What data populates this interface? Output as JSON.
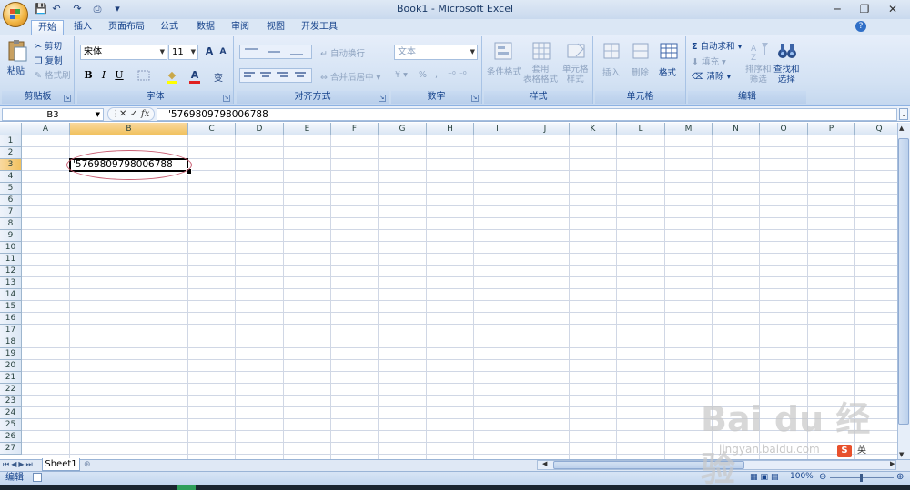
{
  "title_bar": {
    "title": "Book1 - Microsoft Excel",
    "minimize": "─",
    "restore": "❐",
    "close": "✕"
  },
  "qat": {
    "save": "💾",
    "undo": "↶",
    "redo": "↷",
    "print": "⎙",
    "more": "▾"
  },
  "tabs": [
    "开始",
    "插入",
    "页面布局",
    "公式",
    "数据",
    "审阅",
    "视图",
    "开发工具"
  ],
  "help": "?",
  "ribbon": {
    "clipboard": {
      "paste": "粘贴",
      "cut": "剪切",
      "copy": "复制",
      "format_painter": "格式刷",
      "label": "剪贴板"
    },
    "font": {
      "font_name": "宋体",
      "font_size": "11",
      "bold": "B",
      "italic": "I",
      "underline": "U",
      "label": "字体",
      "grow": "A",
      "shrink": "A",
      "font_color": "A",
      "fill": "◆",
      "wen": "变"
    },
    "alignment": {
      "wrap_text": "自动换行",
      "merge_center": "合并后居中",
      "label": "对齐方式"
    },
    "number": {
      "format": "文本",
      "percent": "%",
      "comma": ",",
      "label": "数字"
    },
    "styles": {
      "conditional": "条件格式",
      "table_format": "套用\n表格格式",
      "cell_styles": "单元格\n样式",
      "label": "样式"
    },
    "cells": {
      "insert": "插入",
      "delete": "删除",
      "format": "格式",
      "label": "单元格"
    },
    "editing": {
      "autosum": "自动求和",
      "fill": "填充",
      "clear": "清除",
      "sort_filter": "排序和\n筛选",
      "find_select": "查找和\n选择",
      "label": "编辑"
    }
  },
  "formula_bar": {
    "name_box": "B3",
    "cancel": "✕",
    "enter": "✓",
    "fx": "fx",
    "content": "'5769809798006788"
  },
  "columns": [
    "A",
    "B",
    "C",
    "D",
    "E",
    "F",
    "G",
    "H",
    "I",
    "J",
    "K",
    "L",
    "M",
    "N",
    "O",
    "P",
    "Q"
  ],
  "selected_column": "B",
  "rows": [
    "1",
    "2",
    "3",
    "4",
    "5",
    "6",
    "7",
    "8",
    "9",
    "10",
    "11",
    "12",
    "13",
    "14",
    "15",
    "16",
    "17",
    "18",
    "19",
    "20",
    "21",
    "22",
    "23",
    "24",
    "25",
    "26",
    "27"
  ],
  "selected_row": "3",
  "active_cell": {
    "ref": "B3",
    "value": "'5769809798006788"
  },
  "sheet_tabs": [
    "Sheet1"
  ],
  "status": {
    "mode": "编辑",
    "zoom": "100%"
  },
  "watermark": {
    "brand": "Bai du 经验",
    "url": "jingyan.baidu.com"
  },
  "ime": {
    "logo": "S",
    "lang": "英"
  }
}
